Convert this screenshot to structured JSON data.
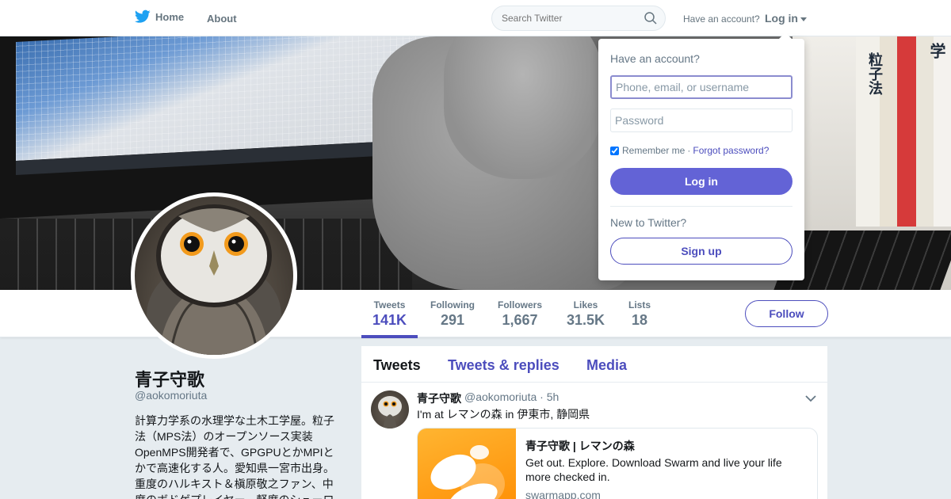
{
  "nav": {
    "home": "Home",
    "about": "About",
    "search_placeholder": "Search Twitter",
    "have_account": "Have an account?",
    "login": "Log in"
  },
  "profile": {
    "name": "青子守歌",
    "handle": "@aokomoriuta",
    "bio": "計算力学系の水理学な土木工学屋。粒子法（MPS法）のオープンソース実装OpenMPS開発者で、GPGPUとかMPIとかで高速化する人。愛知県一宮市出身。重度のハルキスト＆槇原敬之ファン、中度のボドゲプレイヤー、軽度のシューロ"
  },
  "banner": {
    "book_title_1": "粒子法",
    "book_title_2": "学"
  },
  "stats": [
    {
      "label": "Tweets",
      "value": "141K",
      "active": true
    },
    {
      "label": "Following",
      "value": "291"
    },
    {
      "label": "Followers",
      "value": "1,667"
    },
    {
      "label": "Likes",
      "value": "31.5K"
    },
    {
      "label": "Lists",
      "value": "18"
    }
  ],
  "follow_button": "Follow",
  "tabs": [
    "Tweets",
    "Tweets & replies",
    "Media"
  ],
  "tweet": {
    "name": "青子守歌",
    "handle_time": "@aokomoriuta · 5h",
    "text": "I'm at レマンの森 in 伊東市, 静岡県",
    "card": {
      "title": "青子守歌 | レマンの森",
      "description": "Get out. Explore. Download Swarm and live your life more checked in.",
      "url": "swarmapp.com"
    }
  },
  "login_dropdown": {
    "heading": "Have an account?",
    "username_placeholder": "Phone, email, or username",
    "password_placeholder": "Password",
    "remember": "Remember me",
    "separator": "·",
    "forgot": "Forgot password?",
    "login_button": "Log in",
    "new_to": "New to Twitter?",
    "signup_button": "Sign up"
  },
  "colors": {
    "accent": "#4c4dbd",
    "button_fill": "#6363d6",
    "twitter_blue": "#1da1f2",
    "swarm_orange": "#ff9f1a"
  }
}
